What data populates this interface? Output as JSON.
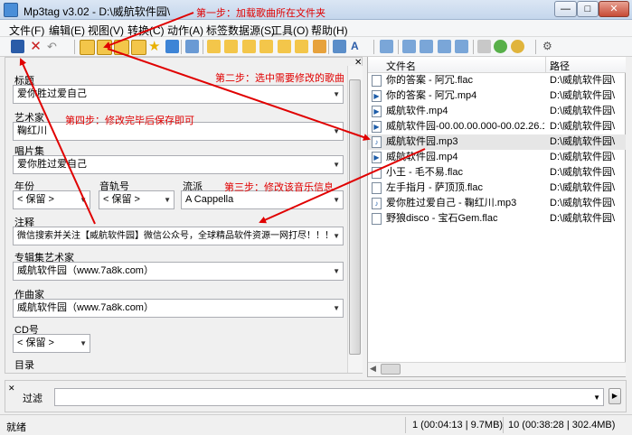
{
  "window": {
    "title": "Mp3tag v3.02  -  D:\\威航软件园\\",
    "controls": [
      "—",
      "□",
      "✕"
    ]
  },
  "menu": [
    "文件(F)",
    "编辑(E)",
    "视图(V)",
    "转换(C)",
    "动作(A)",
    "标签数据源(S)",
    "工具(O)",
    "帮助(H)"
  ],
  "fields": {
    "title_label": "标题",
    "title_value": "爱你胜过爱自己",
    "artist_label": "艺术家",
    "artist_value": "鞠红川",
    "album_label": "唱片集",
    "album_value": "爱你胜过爱自己",
    "year_label": "年份",
    "year_value": "< 保留 >",
    "track_label": "音轨号",
    "track_value": "< 保留 >",
    "genre_label": "流派",
    "genre_value": "A Cappella",
    "comment_label": "注释",
    "comment_value": "微信搜索并关注【威航软件园】微信公众号，全球精品软件资源一网打尽！！！",
    "album_artist_label": "专辑集艺术家",
    "album_artist_value": "威航软件园（www.7a8k.com）",
    "composer_label": "作曲家",
    "composer_value": "威航软件园（www.7a8k.com）",
    "cd_label": "CD号",
    "cd_value": "< 保留 >",
    "directory_label": "目录"
  },
  "file_list": {
    "col_name": "文件名",
    "col_path": "路径",
    "rows": [
      {
        "name": "你的答案 - 阿冗.flac",
        "path": "D:\\威航软件园\\",
        "type": "flac"
      },
      {
        "name": "你的答案 - 阿冗.mp4",
        "path": "D:\\威航软件园\\",
        "type": "mp4"
      },
      {
        "name": "威航软件.mp4",
        "path": "D:\\威航软件园\\",
        "type": "mp4"
      },
      {
        "name": "威航软件园-00.00.00.000-00.02.26.1...",
        "path": "D:\\威航软件园\\",
        "type": "mp4"
      },
      {
        "name": "威航软件园.mp3",
        "path": "D:\\威航软件园\\",
        "type": "mp3",
        "selected": true
      },
      {
        "name": "威航软件园.mp4",
        "path": "D:\\威航软件园\\",
        "type": "mp4"
      },
      {
        "name": "小王 - 毛不易.flac",
        "path": "D:\\威航软件园\\",
        "type": "flac"
      },
      {
        "name": "左手指月 - 萨顶顶.flac",
        "path": "D:\\威航软件园\\",
        "type": "flac"
      },
      {
        "name": "爱你胜过爱自己 - 鞠红川.mp3",
        "path": "D:\\威航软件园\\",
        "type": "mp3"
      },
      {
        "name": "野狼disco - 宝石Gem.flac",
        "path": "D:\\威航软件园\\",
        "type": "flac"
      }
    ]
  },
  "filter": {
    "label": "过滤",
    "value": ""
  },
  "status": {
    "left": "就绪",
    "selected_info": "1 (00:04:13 | 9.7MB)",
    "total_info": "10 (00:38:28 | 302.4MB)"
  },
  "annotations": {
    "step1": "第一步：加载歌曲所在文件夹",
    "step2": "第二步：选中需要修改的歌曲",
    "step3": "第三步：修改该音乐信息",
    "step4": "第四步：修改完毕后保存即可",
    "color": "#e00000"
  },
  "icons": [
    "save-icon",
    "delete-icon",
    "undo-icon",
    "change-dir-icon",
    "add-dir-icon",
    "open-folder-icon",
    "save-folder-icon",
    "favorite-icon",
    "refresh-icon",
    "list-icon",
    "tag-tools-icon",
    "action-icon",
    "settings-icon"
  ]
}
